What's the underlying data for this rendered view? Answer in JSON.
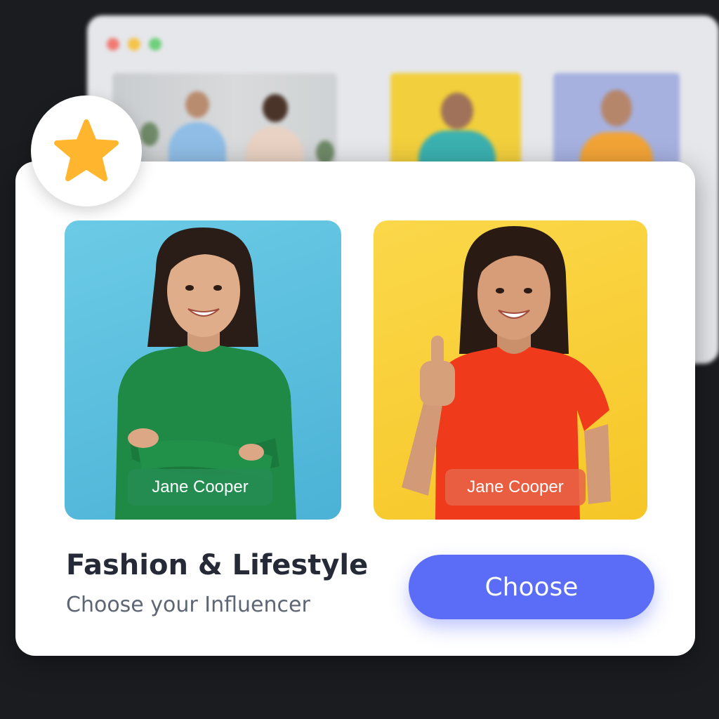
{
  "window": {
    "controls": [
      "close",
      "minimize",
      "maximize"
    ],
    "control_colors": [
      "#f07a72",
      "#f5c447",
      "#6ccf7a"
    ]
  },
  "badge": {
    "icon": "star-icon",
    "color": "#ffb62e"
  },
  "card": {
    "title": "Fashion & Lifestyle",
    "subtitle": "Choose your Influencer",
    "button_label": "Choose",
    "button_color": "#5b6cf6"
  },
  "influencers": [
    {
      "name": "Jane Cooper",
      "background": "#5dbfde",
      "tag_color": "#268c52"
    },
    {
      "name": "Jane Cooper",
      "background": "#f9cf33",
      "tag_color": "#e86448"
    }
  ]
}
